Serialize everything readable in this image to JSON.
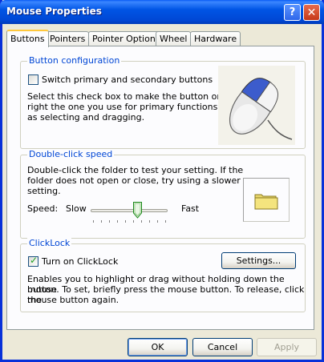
{
  "window": {
    "title": "Mouse Properties",
    "help_glyph": "?",
    "close_glyph": "✕"
  },
  "tabs": [
    {
      "label": "Buttons",
      "active": true
    },
    {
      "label": "Pointers",
      "active": false
    },
    {
      "label": "Pointer Options",
      "active": false
    },
    {
      "label": "Wheel",
      "active": false
    },
    {
      "label": "Hardware",
      "active": false
    }
  ],
  "button_config": {
    "group_label": "Button configuration",
    "checkbox_label": "Switch primary and secondary buttons",
    "checked": false,
    "desc_lines": [
      "Select this check box to make the button on the",
      "right the one you use for primary functions such",
      "as selecting and dragging."
    ],
    "image_icon": "mouse-icon"
  },
  "double_click": {
    "group_label": "Double-click speed",
    "desc_lines": [
      "Double-click the folder to test your setting. If the",
      "folder does not open or close, try using a slower",
      "setting."
    ],
    "speed_label": "Speed:",
    "slow_label": "Slow",
    "fast_label": "Fast",
    "slider_fraction": 0.6,
    "folder_icon": "folder-icon"
  },
  "clicklock": {
    "group_label": "ClickLock",
    "checkbox_label": "Turn on ClickLock",
    "checked": true,
    "settings_label": "Settings...",
    "desc_lines": [
      "Enables you to highlight or drag without holding down the mouse",
      "button. To set, briefly press the mouse button. To release, click the",
      "mouse button again."
    ]
  },
  "footer": {
    "ok_label": "OK",
    "cancel_label": "Cancel",
    "apply_label": "Apply"
  },
  "colors": {
    "titlebar": "#0055e5",
    "group_label": "#0046d5",
    "face": "#ece9d8"
  }
}
